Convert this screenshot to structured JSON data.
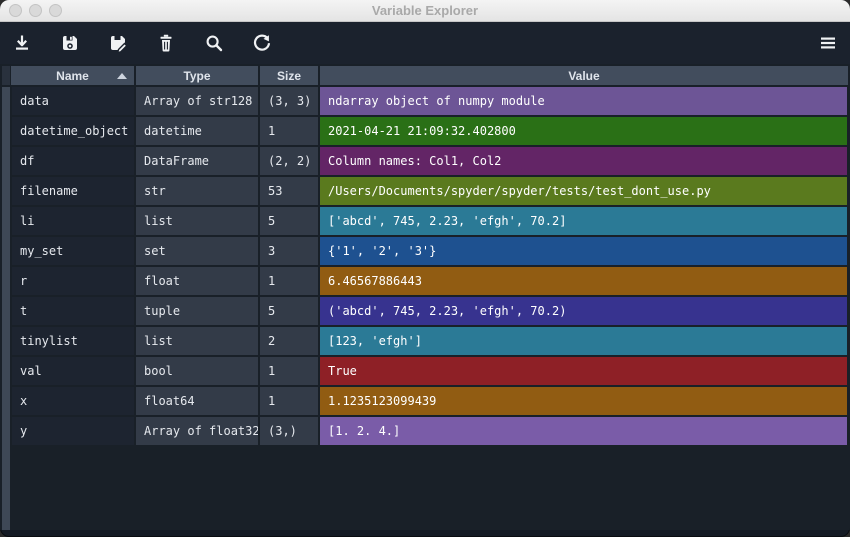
{
  "window": {
    "title": "Variable Explorer"
  },
  "toolbar": {
    "buttons": [
      "import-data",
      "save-data",
      "save-data-as",
      "remove-variable",
      "search",
      "refresh"
    ],
    "options_button": "options-menu"
  },
  "table": {
    "columns": [
      {
        "label": "Name",
        "sorted": "ascending"
      },
      {
        "label": "Type"
      },
      {
        "label": "Size"
      },
      {
        "label": "Value"
      }
    ],
    "rows": [
      {
        "name": "data",
        "type": "Array of str128",
        "size": "(3, 3)",
        "value": "ndarray object of numpy module",
        "color": "#6d5596"
      },
      {
        "name": "datetime_object",
        "type": "datetime",
        "size": "1",
        "value": "2021-04-21 21:09:32.402800",
        "color": "#2a7016"
      },
      {
        "name": "df",
        "type": "DataFrame",
        "size": "(2, 2)",
        "value": "Column names: Col1, Col2",
        "color": "#632566"
      },
      {
        "name": "filename",
        "type": "str",
        "size": "53",
        "value": "/Users/Documents/spyder/spyder/tests/test_dont_use.py",
        "color": "#5a7a1e"
      },
      {
        "name": "li",
        "type": "list",
        "size": "5",
        "value": "['abcd', 745, 2.23, 'efgh', 70.2]",
        "color": "#2b7a96"
      },
      {
        "name": "my_set",
        "type": "set",
        "size": "3",
        "value": "{'1', '2', '3'}",
        "color": "#1e5190"
      },
      {
        "name": "r",
        "type": "float",
        "size": "1",
        "value": "6.46567886443",
        "color": "#915c12"
      },
      {
        "name": "t",
        "type": "tuple",
        "size": "5",
        "value": "('abcd', 745, 2.23, 'efgh', 70.2)",
        "color": "#37338f"
      },
      {
        "name": "tinylist",
        "type": "list",
        "size": "2",
        "value": "[123, 'efgh']",
        "color": "#2b7a96"
      },
      {
        "name": "val",
        "type": "bool",
        "size": "1",
        "value": "True",
        "color": "#8e2026"
      },
      {
        "name": "x",
        "type": "float64",
        "size": "1",
        "value": "1.1235123099439",
        "color": "#915c12"
      },
      {
        "name": "y",
        "type": "Array of float32",
        "size": "(3,)",
        "value": "[1. 2. 4.]",
        "color": "#7a5ca8"
      }
    ]
  },
  "colors": {
    "toolbar_bg": "#1b222d",
    "table_bg": "#192028",
    "header_bg": "#424d5d",
    "name_cell_bg": "#1d2430",
    "meta_cell_bg": "#333b48",
    "row_header_bg": "#3e4856",
    "cell_text": "#e6e9ee"
  }
}
